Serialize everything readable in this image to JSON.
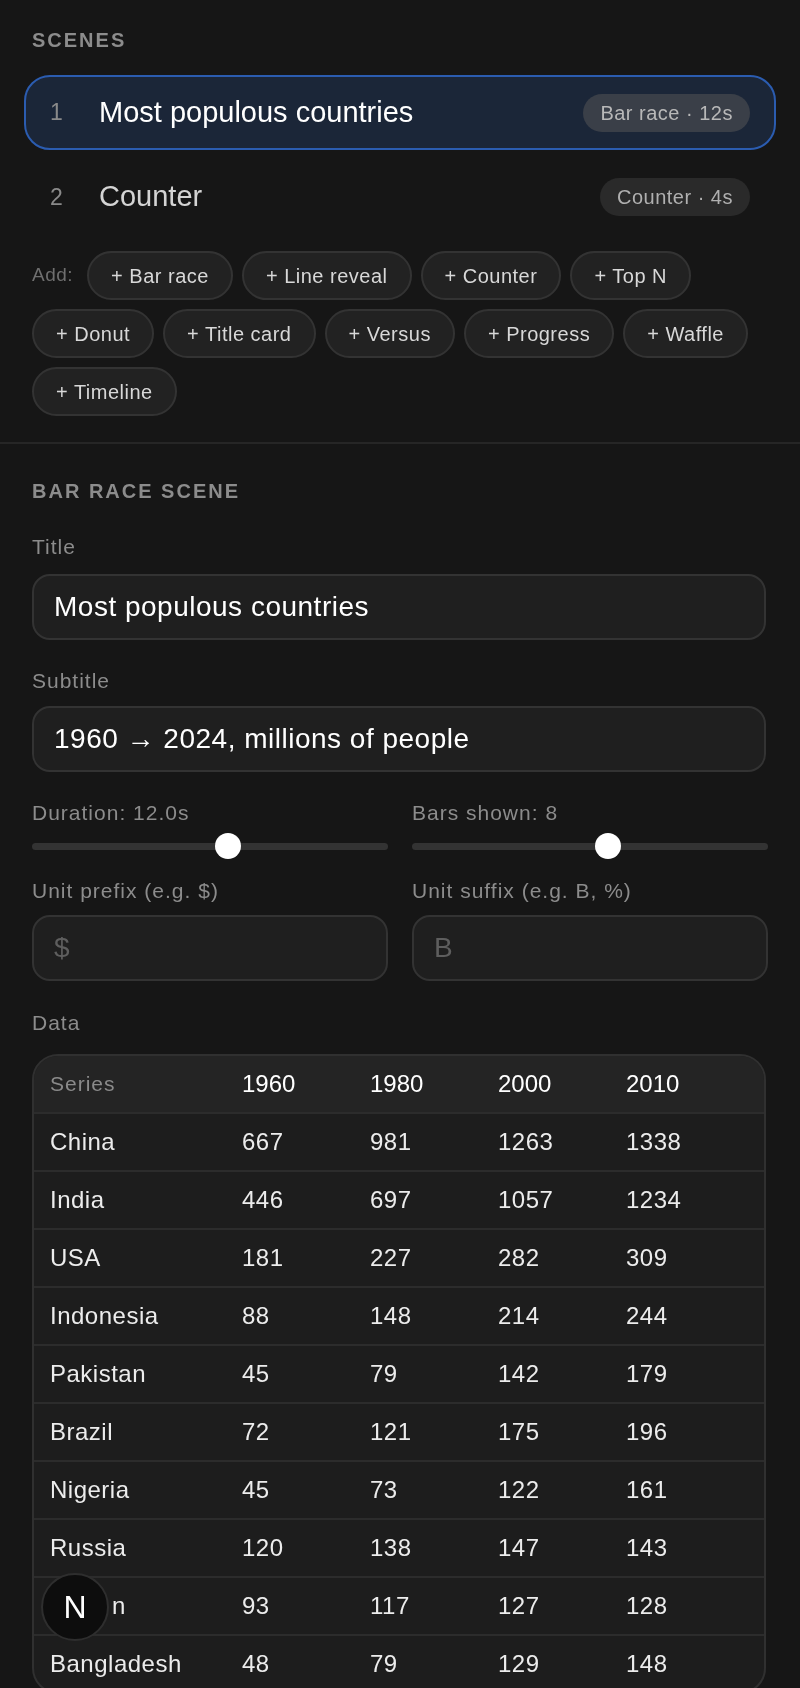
{
  "scenes_heading": "SCENES",
  "scenes": [
    {
      "number": "1",
      "title": "Most populous countries",
      "badge": "Bar race · 12s",
      "selected": true
    },
    {
      "number": "2",
      "title": "Counter",
      "badge": "Counter · 4s",
      "selected": false
    }
  ],
  "add_label": "Add:",
  "add_buttons": [
    "+ Bar race",
    "+ Line reveal",
    "+ Counter",
    "+ Top N",
    "+ Donut",
    "+ Title card",
    "+ Versus",
    "+ Progress",
    "+ Waffle",
    "+ Timeline"
  ],
  "editor": {
    "heading": "BAR RACE SCENE",
    "fields": [
      {
        "label": "Title",
        "value": "Most populous countries"
      },
      {
        "label": "Subtitle",
        "value": "1960 → 2024, millions of people"
      }
    ],
    "sliders": [
      {
        "label": "Duration: 12.0s",
        "level": 0.55
      },
      {
        "label": "Bars shown: 8",
        "level": 0.55
      }
    ],
    "unit_fields": [
      {
        "label": "Unit prefix (e.g. $)",
        "placeholder": "$"
      },
      {
        "label": "Unit suffix (e.g. B, %)",
        "placeholder": "B"
      }
    ],
    "data_label": "Data",
    "table": {
      "columns": [
        "Series",
        "1960",
        "1980",
        "2000",
        "2010"
      ],
      "rows": [
        [
          "China",
          "667",
          "981",
          "1263",
          "1338"
        ],
        [
          "India",
          "446",
          "697",
          "1057",
          "1234"
        ],
        [
          "USA",
          "181",
          "227",
          "282",
          "309"
        ],
        [
          "Indonesia",
          "88",
          "148",
          "214",
          "244"
        ],
        [
          "Pakistan",
          "45",
          "79",
          "142",
          "179"
        ],
        [
          "Brazil",
          "72",
          "121",
          "175",
          "196"
        ],
        [
          "Nigeria",
          "45",
          "73",
          "122",
          "161"
        ],
        [
          "Russia",
          "120",
          "138",
          "147",
          "143"
        ],
        [
          "n",
          "93",
          "117",
          "127",
          "128"
        ],
        [
          "Bangladesh",
          "48",
          "79",
          "129",
          "148"
        ]
      ]
    }
  },
  "floating_badge": "N"
}
